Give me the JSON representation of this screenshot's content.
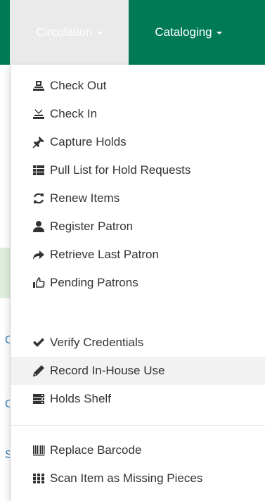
{
  "nav": {
    "circulation_label": "Circulation",
    "cataloging_label": "Cataloging"
  },
  "page": {
    "left_chars": [
      "C",
      "C",
      "S"
    ]
  },
  "menu": {
    "items": [
      {
        "label": "Check Out",
        "icon": "check-out-icon"
      },
      {
        "label": "Check In",
        "icon": "check-in-icon"
      },
      {
        "label": "Capture Holds",
        "icon": "pushpin-icon"
      },
      {
        "label": "Pull List for Hold Requests",
        "icon": "list-icon"
      },
      {
        "label": "Renew Items",
        "icon": "refresh-icon"
      },
      {
        "label": "Register Patron",
        "icon": "user-icon"
      },
      {
        "label": "Retrieve Last Patron",
        "icon": "share-arrow-icon"
      },
      {
        "label": "Pending Patrons",
        "icon": "thumbs-up-icon"
      },
      {
        "label": "Verify Credentials",
        "icon": "checkmark-icon"
      },
      {
        "label": "Record In-House Use",
        "icon": "pencil-icon"
      },
      {
        "label": "Holds Shelf",
        "icon": "hdd-icon"
      },
      {
        "label": "Replace Barcode",
        "icon": "barcode-icon"
      },
      {
        "label": "Scan Item as Missing Pieces",
        "icon": "th-icon"
      }
    ]
  },
  "colors": {
    "navbar": "#007a54",
    "circulation_tab": "#eaeaea",
    "hover_row": "#f2f2f2",
    "text": "#333333"
  }
}
